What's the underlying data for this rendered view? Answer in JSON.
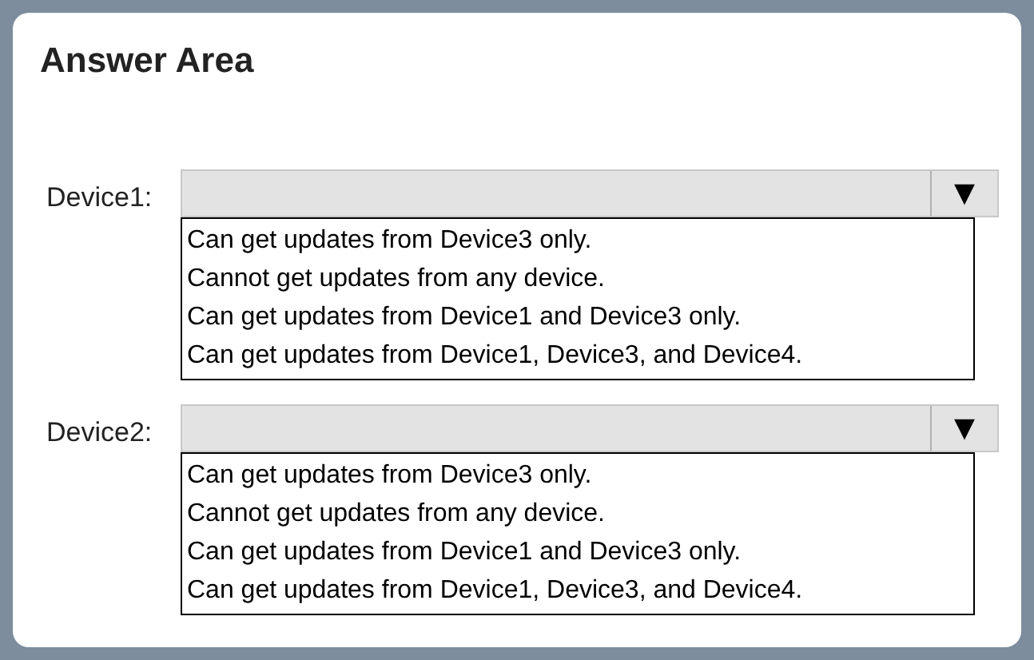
{
  "title": "Answer Area",
  "devices": [
    {
      "label": "Device1:",
      "options": [
        "Can get updates from Device3 only.",
        "Cannot get updates from any device.",
        "Can get updates from Device1 and Device3 only.",
        "Can get updates from Device1, Device3, and Device4."
      ]
    },
    {
      "label": "Device2:",
      "options": [
        "Can get updates from Device3 only.",
        "Cannot get updates from any device.",
        "Can get updates from Device1 and Device3 only.",
        "Can get updates from Device1, Device3, and Device4."
      ]
    }
  ],
  "arrow": "▼"
}
